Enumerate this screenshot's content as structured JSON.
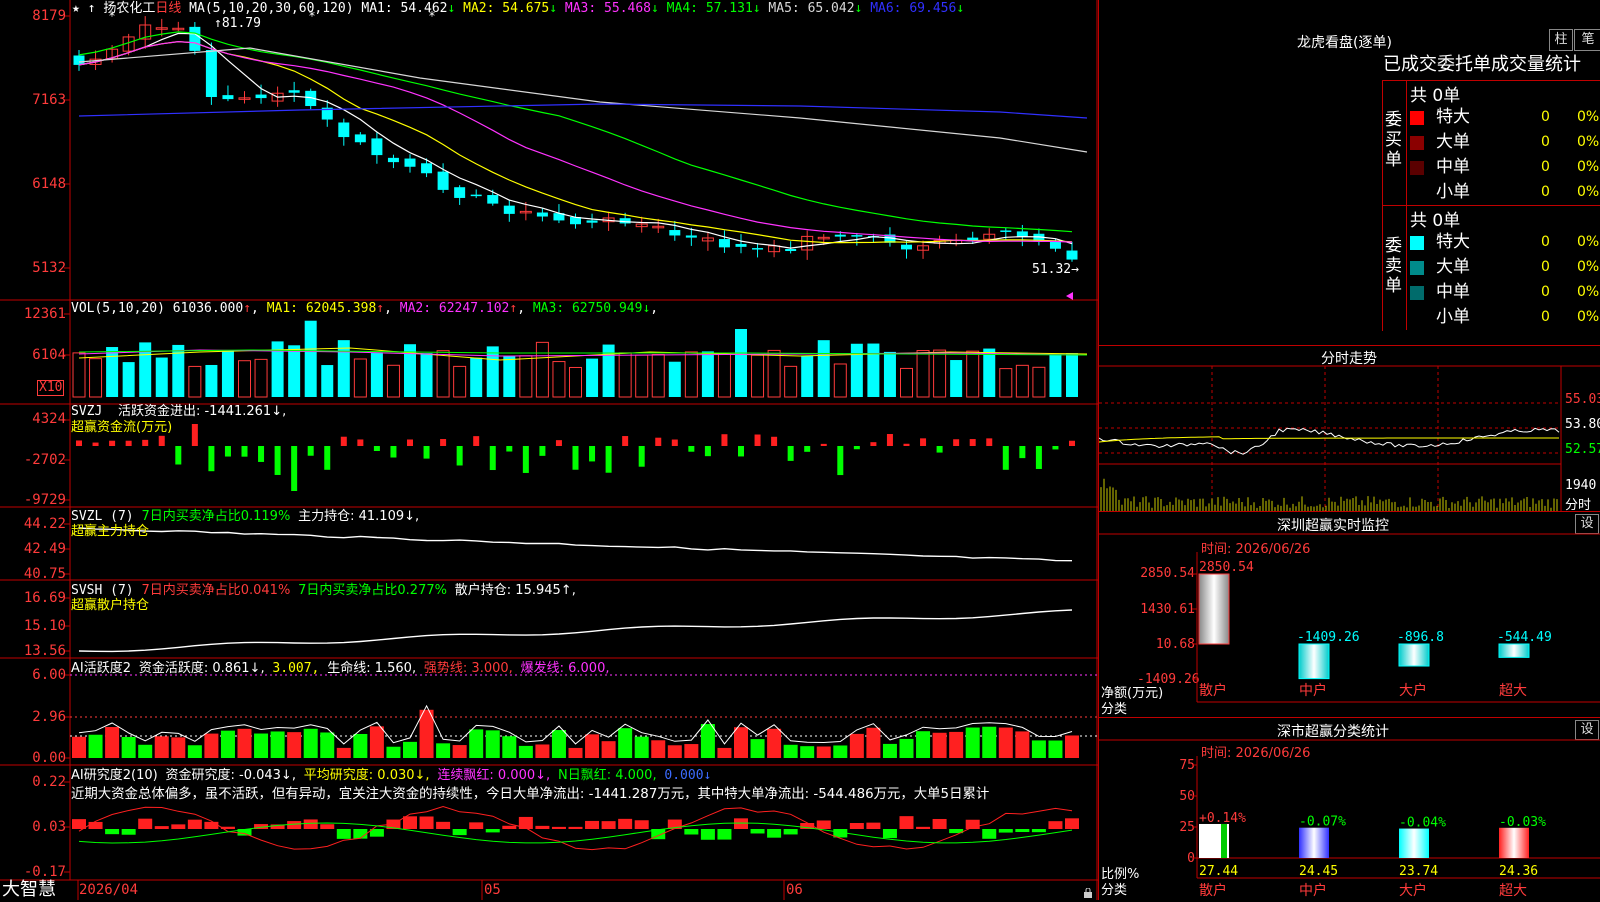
{
  "stock": {
    "name": "扬农化工",
    "period": "日线"
  },
  "main": {
    "ma_header": "MA(5,10,20,30,60,120)",
    "ma_values": [
      {
        "label": "MA1:",
        "value": "54.462",
        "arrow": "↓",
        "color": "#ffffff"
      },
      {
        "label": "MA2:",
        "value": "54.675",
        "arrow": "↓",
        "color": "#ffff00"
      },
      {
        "label": "MA3:",
        "value": "55.468",
        "arrow": "↓",
        "color": "#ff33ff"
      },
      {
        "label": "MA4:",
        "value": "57.131",
        "arrow": "↓",
        "color": "#00ff00"
      },
      {
        "label": "MA5:",
        "value": "65.042",
        "arrow": "↓",
        "color": "#d8d8d8"
      },
      {
        "label": "MA6:",
        "value": "69.456",
        "arrow": "↓",
        "color": "#3030ff"
      }
    ],
    "yaxis": [
      "8179",
      "7163",
      "6148",
      "5132"
    ],
    "high_label": "81.79",
    "low_label": "51.32"
  },
  "vol": {
    "header": "VOL(5,10,20)",
    "value": "61036.000",
    "arrow": "↑",
    "mas": [
      {
        "label": "MA1:",
        "value": "62045.398",
        "arrow": "↑",
        "color": "#ffff00"
      },
      {
        "label": "MA2:",
        "value": "62247.102",
        "arrow": "↑",
        "color": "#ff33ff"
      },
      {
        "label": "MA3:",
        "value": "62750.949",
        "arrow": "↓",
        "color": "#00ff00"
      }
    ],
    "yaxis": [
      "12361",
      "6104"
    ],
    "unit": "X10"
  },
  "svzj": {
    "header": "SVZJ",
    "text": "活跃资金进出: -1441.261↓,",
    "subtitle": "超赢资金流(万元)",
    "yaxis": [
      "4324",
      "-2702",
      "-9729"
    ]
  },
  "svzl": {
    "header": "SVZL (7)",
    "text1": "7日内买卖净占比0.119%",
    "text2": "主力持仓: 41.109↓,",
    "subtitle": "超赢主力持仓",
    "yaxis": [
      "44.22",
      "42.49",
      "40.75"
    ]
  },
  "svsh": {
    "header": "SVSH (7)",
    "text1": "7日内买卖净占比0.041%",
    "text2": "7日内买卖净占比0.277%",
    "text3": "散户持仓: 15.945↑,",
    "subtitle": "超赢散户持仓",
    "yaxis": [
      "16.69",
      "15.10",
      "13.56"
    ]
  },
  "ai1": {
    "header": "AI活跃度2",
    "t1": "资金活跃度: 0.861↓,",
    "t2": "3.007,",
    "t3": "生命线: 1.560,",
    "t4": "强势线: 3.000,",
    "t5": "爆发线: 6.000,",
    "yaxis": [
      "6.00",
      "2.96",
      "0.00"
    ]
  },
  "ai2": {
    "header": "AI研究度2(10)",
    "t1": "资金研究度: -0.043↓,",
    "t2": "平均研究度: 0.030↓,",
    "t3": "连续飘红: 0.000↓,",
    "t4": "N日飘红: 4.000,",
    "t5": "0.000↓",
    "comment": "近期大资金总体偏多，虽不活跃，但有异动，宜关注大资金的持续性，今日大单净流出: -1441.287万元，其中特大单净流出: -544.486万元，大单5日累计",
    "yaxis": [
      "0.22",
      "0.03",
      "-0.17"
    ]
  },
  "bottom": {
    "brand": "大智慧",
    "dates": [
      "2026/04",
      "05",
      "06"
    ]
  },
  "dragon": {
    "title": "龙虎看盘(逐单)",
    "btn_bar": "柱",
    "btn_pen": "笔",
    "tabs": "已成交委托单成交量统计",
    "buy_label": "委买单",
    "sell_label": "委卖单",
    "buy_total": "共 0单",
    "sell_total": "共 0单",
    "buy_rows": [
      {
        "name": "特大",
        "qty": "0",
        "pct": "0%",
        "color": "#ff0000"
      },
      {
        "name": "大单",
        "qty": "0",
        "pct": "0%",
        "color": "#8b0000"
      },
      {
        "name": "中单",
        "qty": "0",
        "pct": "0%",
        "color": "#5a0000"
      },
      {
        "name": "小单",
        "qty": "0",
        "pct": "0%",
        "color": ""
      }
    ],
    "sell_rows": [
      {
        "name": "特大",
        "qty": "0",
        "pct": "0%",
        "color": "#00ffff"
      },
      {
        "name": "大单",
        "qty": "0",
        "pct": "0%",
        "color": "#008b8b"
      },
      {
        "name": "中单",
        "qty": "0",
        "pct": "0%",
        "color": "#006b6b"
      },
      {
        "name": "小单",
        "qty": "0",
        "pct": "0%",
        "color": ""
      }
    ]
  },
  "intraday": {
    "title": "分时走势",
    "yaxis": [
      "55.03",
      "53.80",
      "52.57"
    ],
    "vol_label": "1940",
    "vol_unit": "分时"
  },
  "monitor": {
    "title": "深圳超赢实时监控",
    "set": "设",
    "time": "时间: 2026/06/26",
    "yaxis": [
      "2850.54",
      "1430.61",
      "10.68",
      "-1409.26"
    ],
    "unit1": "净额(万元)",
    "unit2": "分类",
    "bars": [
      {
        "label": "散户",
        "value": "2850.54"
      },
      {
        "label": "中户",
        "value": "-1409.26"
      },
      {
        "label": "大户",
        "value": "-896.8"
      },
      {
        "label": "超大",
        "value": "-544.49"
      }
    ]
  },
  "classify": {
    "title": "深市超赢分类统计",
    "set": "设",
    "time": "时间: 2026/06/26",
    "yaxis": [
      "75",
      "50",
      "25",
      "0"
    ],
    "unit1": "比例%",
    "unit2": "分类",
    "bars": [
      {
        "label": "散户",
        "pct": "+0.14%",
        "value": "27.44"
      },
      {
        "label": "中户",
        "pct": "-0.07%",
        "value": "24.45"
      },
      {
        "label": "大户",
        "pct": "-0.04%",
        "value": "23.74"
      },
      {
        "label": "超大",
        "pct": "-0.03%",
        "value": "24.36"
      }
    ]
  }
}
